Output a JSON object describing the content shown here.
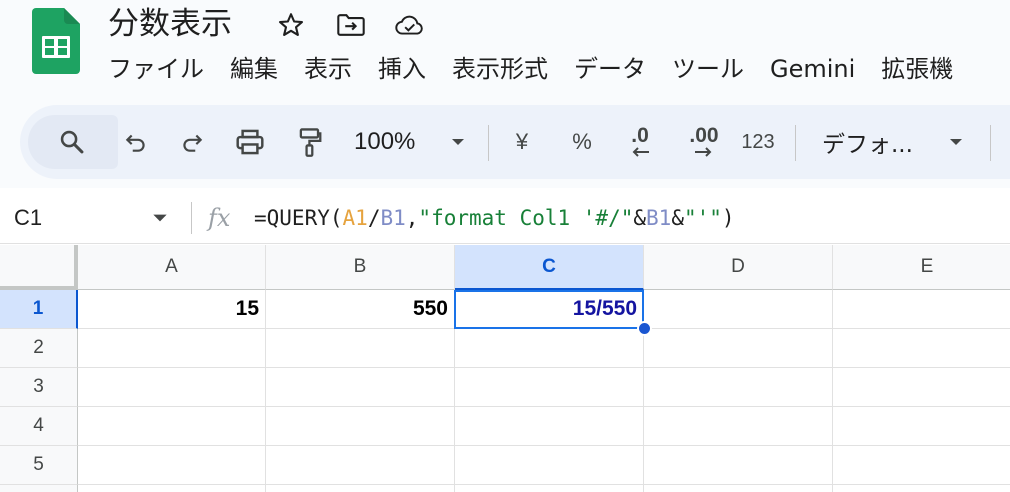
{
  "document": {
    "title": "分数表示"
  },
  "title_icons": {
    "star": "star-icon",
    "move": "move-to-folder-icon",
    "cloud": "cloud-status-icon"
  },
  "menu": [
    "ファイル",
    "編集",
    "表示",
    "挿入",
    "表示形式",
    "データ",
    "ツール",
    "Gemini",
    "拡張機"
  ],
  "toolbar": {
    "zoom": "100%",
    "currency": "¥",
    "percent": "%",
    "decrease_decimal": ".0",
    "increase_decimal": ".00",
    "more_formats": "123",
    "font": "デフォ..."
  },
  "formula_bar": {
    "name_box": "C1",
    "fx": "fx",
    "formula": {
      "prefix": "=QUERY(",
      "ref1": "A1",
      "slash": "/",
      "ref2": "B1",
      "comma": ",",
      "str1": "\"format Col1 '#/\"",
      "amp1": "&",
      "ref3": "B1",
      "amp2": "&",
      "str2": "\"'\"",
      "suffix": ")"
    }
  },
  "grid": {
    "columns": [
      "A",
      "B",
      "C",
      "D",
      "E"
    ],
    "rows": [
      "1",
      "2",
      "3",
      "4",
      "5"
    ],
    "selected_cell": "C1",
    "cells": {
      "A1": "15",
      "B1": "550",
      "C1": "15/550"
    }
  },
  "colors": {
    "accent": "#0b57d0",
    "selection_bg": "#d3e3fd",
    "formula_ref_a": "#e6a33e",
    "formula_ref_b": "#7f8cc6",
    "formula_string": "#188038",
    "result_text": "#1414a0"
  }
}
